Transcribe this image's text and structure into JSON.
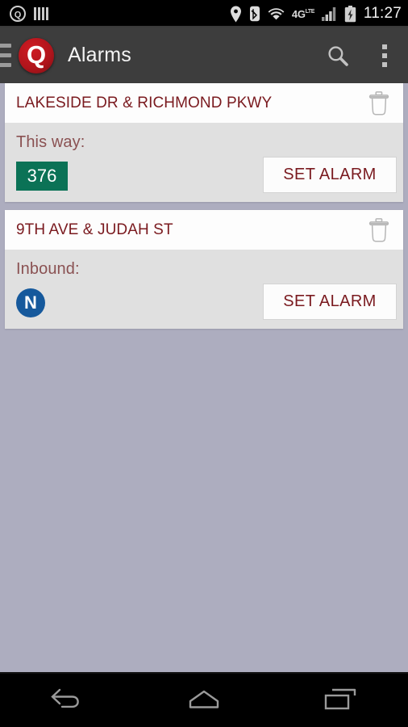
{
  "status_bar": {
    "notification_icons": [
      "quantum-q-notification-icon",
      "barcode-icon"
    ],
    "location_icon": "location-pin-icon",
    "bluetooth_icon": "bluetooth-icon",
    "wifi_icon": "wifi-icon",
    "network_type": "4G",
    "network_type_sup": "LTE",
    "signal_icon": "signal-bars-icon",
    "battery_icon": "battery-charging-icon",
    "time": "11:27"
  },
  "action_bar": {
    "drawer_icon": "hamburger-menu-icon",
    "logo_letter": "Q",
    "title": "Alarms",
    "search_icon": "search-icon",
    "overflow_icon": "overflow-menu-icon"
  },
  "alarms": [
    {
      "stop_name": "LAKESIDE DR & RICHMOND PKWY",
      "direction": "This way:",
      "route": "376",
      "route_badge_shape": "rect",
      "route_badge_color": "#0b7256",
      "action_label": "SET ALARM",
      "delete_icon": "trash-icon"
    },
    {
      "stop_name": "9TH AVE & JUDAH ST",
      "direction": "Inbound:",
      "route": "N",
      "route_badge_shape": "circle",
      "route_badge_color": "#16599c",
      "action_label": "SET ALARM",
      "delete_icon": "trash-icon"
    }
  ],
  "nav_bar": {
    "back_icon": "back-arrow-icon",
    "home_icon": "home-icon",
    "recents_icon": "recent-apps-icon"
  },
  "theme": {
    "page_background": "#adadbf",
    "action_bar_background": "#3d3d3d",
    "card_header_background": "#fdfdfd",
    "card_body_background": "#e0e0e0",
    "accent_red": "#7a1a1f",
    "direction_text": "#8a5152",
    "logo_red": "#b0151c"
  }
}
